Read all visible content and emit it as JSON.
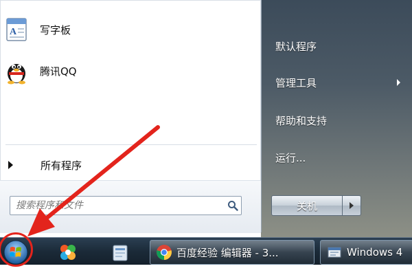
{
  "start_menu": {
    "programs": [
      {
        "label": "写字板",
        "icon": "wordpad-icon"
      },
      {
        "label": "腾讯QQ",
        "icon": "qq-penguin-icon"
      }
    ],
    "all_programs_label": "所有程序",
    "search": {
      "placeholder": "搜索程序和文件"
    },
    "right_items": [
      {
        "label": "默认程序",
        "has_submenu": false
      },
      {
        "label": "管理工具",
        "has_submenu": true
      },
      {
        "label": "帮助和支持",
        "has_submenu": false
      },
      {
        "label": "运行...",
        "has_submenu": false
      }
    ],
    "shutdown_label": "关机"
  },
  "taskbar": {
    "windows": [
      {
        "label": "百度经验 编辑器 - 3...",
        "icon": "chrome-icon"
      },
      {
        "label": "Windows 4",
        "icon": "windows-window-icon"
      }
    ],
    "pinned": [
      "start-orb-icon",
      "colorful-app-icon",
      "folder-app-icon"
    ]
  },
  "annotation": {
    "color": "#e3241c"
  }
}
